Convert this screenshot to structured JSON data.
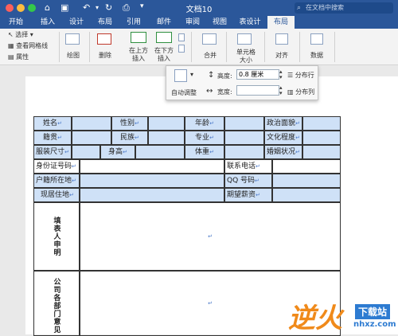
{
  "window": {
    "title": "文档10",
    "search_placeholder": "在文档中搜索"
  },
  "tabs": [
    {
      "label": "开始"
    },
    {
      "label": "插入"
    },
    {
      "label": "设计"
    },
    {
      "label": "布局"
    },
    {
      "label": "引用"
    },
    {
      "label": "邮件"
    },
    {
      "label": "审阅"
    },
    {
      "label": "视图"
    },
    {
      "label": "表设计"
    },
    {
      "label": "布局"
    }
  ],
  "ribbon": {
    "select_label": "选择",
    "gridlines_label": "查看网格线",
    "properties_label": "属性",
    "draw_label": "绘图",
    "delete_label": "删除",
    "insert_above_line1": "在上方",
    "insert_above_line2": "插入",
    "insert_below_line1": "在下方",
    "insert_below_line2": "插入",
    "merge_label": "合并",
    "cell_size_line1": "单元格",
    "cell_size_line2": "大小",
    "align_label": "对齐",
    "data_label": "数据"
  },
  "popup": {
    "autofit_label": "自动调整",
    "height_label": "高度:",
    "height_value": "0.8 厘米",
    "width_label": "宽度:",
    "width_value": "",
    "distribute_rows_label": "分布行",
    "distribute_cols_label": "分布列"
  },
  "table": {
    "name": "姓名",
    "gender": "性别",
    "age": "年龄",
    "political": "政治面貌",
    "native": "籍贯",
    "ethnicity": "民族",
    "major": "专业",
    "education": "文化程度",
    "clothing": "服装尺寸",
    "height": "身高",
    "weight": "体重",
    "marital": "婚姻状况",
    "id_number": "身份证号码",
    "contact": "联系电话",
    "hukou": "户籍所在地",
    "qq": "QQ 号码",
    "address": "现居住地",
    "salary": "期望薪资",
    "declaration": "填表人申明",
    "dept_opinion": "公司各部门意见"
  },
  "watermark": {
    "text": "逆火",
    "site_top": "下载站",
    "site_bottom": "nhxz.com"
  },
  "colors": {
    "brand": "#2b579a",
    "cell_highlight": "#cfe1f7"
  }
}
